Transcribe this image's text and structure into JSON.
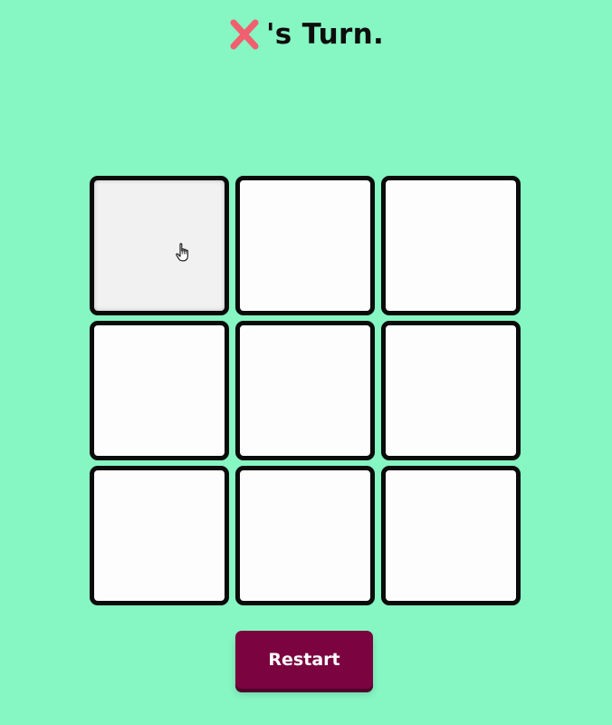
{
  "header": {
    "current_player_icon": "x-mark-icon",
    "current_player_color": "#f25f6f",
    "turn_text": "'s Turn."
  },
  "board": {
    "cells": [
      "",
      "",
      "",
      "",
      "",
      "",
      "",
      "",
      ""
    ],
    "hovered_cell": 0,
    "cell_border_color": "#0b0b0b",
    "cell_fill_color": "#fdfdfd"
  },
  "cursor": {
    "icon": "hand-pointer-icon"
  },
  "controls": {
    "restart_label": "Restart",
    "restart_color": "#7b0340"
  },
  "theme": {
    "background": "#86f6c2"
  }
}
